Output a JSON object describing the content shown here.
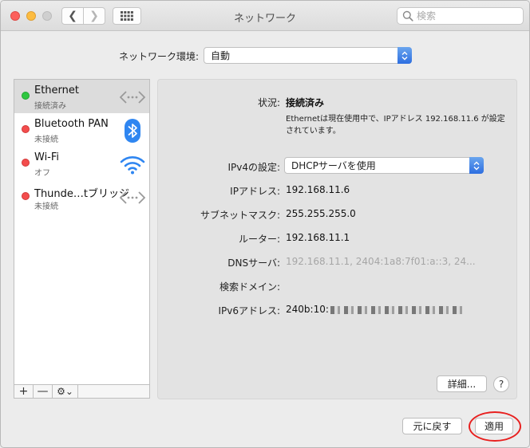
{
  "window": {
    "title": "ネットワーク",
    "search_placeholder": "検索"
  },
  "location": {
    "label": "ネットワーク環境:",
    "value": "自動"
  },
  "services": [
    {
      "name": "Ethernet",
      "status": "接続済み",
      "dot": "#2ec740",
      "icon": "ethernet-icon",
      "selected": true
    },
    {
      "name": "Bluetooth PAN",
      "status": "未接続",
      "dot": "#f34d4d",
      "icon": "bluetooth-icon",
      "selected": false
    },
    {
      "name": "Wi-Fi",
      "status": "オフ",
      "dot": "#f34d4d",
      "icon": "wifi-icon",
      "selected": false
    },
    {
      "name": "Thunde…tブリッジ",
      "status": "未接続",
      "dot": "#f34d4d",
      "icon": "thunderbolt-bridge-icon",
      "selected": false
    }
  ],
  "sidebar_footer": {
    "add": "+",
    "remove": "—",
    "gear": "⚙︎⌄"
  },
  "detail": {
    "status_label": "状況:",
    "status_value": "接続済み",
    "status_desc": "Ethernetは現在使用中で、IPアドレス 192.168.11.6 が設定されています。",
    "ipv4_label": "IPv4の設定:",
    "ipv4_value": "DHCPサーバを使用",
    "ip_label": "IPアドレス:",
    "ip_value": "192.168.11.6",
    "subnet_label": "サブネットマスク:",
    "subnet_value": "255.255.255.0",
    "router_label": "ルーター:",
    "router_value": "192.168.11.1",
    "dns_label": "DNSサーバ:",
    "dns_value": "192.168.11.1, 2404:1a8:7f01:a::3, 24...",
    "search_domain_label": "検索ドメイン:",
    "ipv6_label": "IPv6アドレス:",
    "ipv6_value": "240b:10:",
    "advanced_button": "詳細...",
    "help_button": "?"
  },
  "footer": {
    "revert_button": "元に戻す",
    "apply_button": "適用"
  },
  "colors": {
    "accent": "#2d6ee0",
    "connected": "#2ec740",
    "disconnected": "#f34d4d",
    "highlight": "#e8201f"
  }
}
